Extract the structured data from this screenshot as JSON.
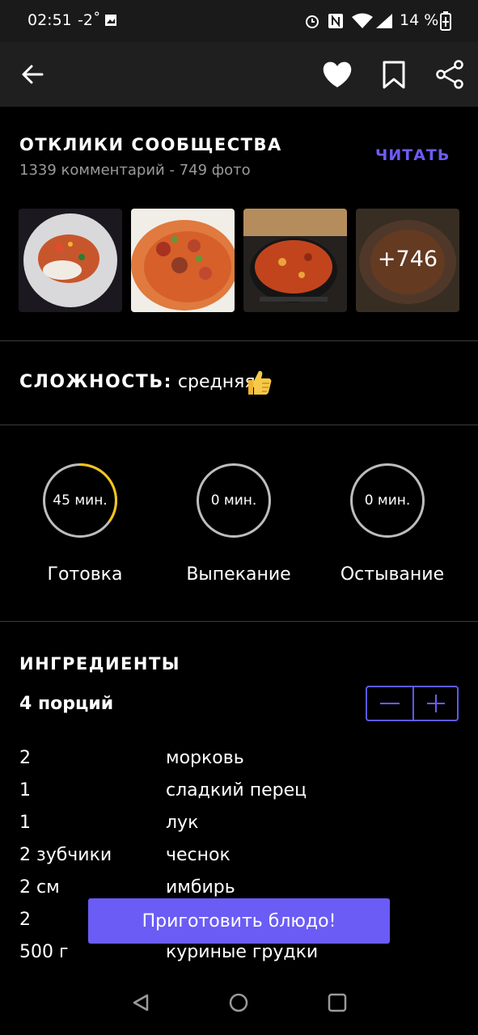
{
  "status": {
    "time": "02:51",
    "temp": "-2˚",
    "battery": "14 %"
  },
  "header": {
    "back_icon": "arrow-left-icon",
    "favorite_icon": "heart-icon",
    "bookmark_icon": "bookmark-icon",
    "share_icon": "share-icon"
  },
  "community": {
    "title": "ОТКЛИКИ СООБЩЕСТВА",
    "subtitle": "1339 комментарий - 749 фото",
    "read_label": "ЧИТАТЬ",
    "more_photos": "+746"
  },
  "difficulty": {
    "label": "СЛОЖНОСТЬ:",
    "value": "средняя",
    "icon": "thumbs-up-icon"
  },
  "times": [
    {
      "value": "45 мин.",
      "label": "Готовка",
      "progress": 0.35
    },
    {
      "value": "0 мин.",
      "label": "Выпекание",
      "progress": 0
    },
    {
      "value": "0 мин.",
      "label": "Остывание",
      "progress": 0
    }
  ],
  "ingredients": {
    "title": "ИНГРЕДИЕНТЫ",
    "portions": "4 порций",
    "minus_label": "−",
    "plus_label": "+",
    "items": [
      {
        "qty": "2",
        "name": "морковь"
      },
      {
        "qty": "1",
        "name": "сладкий перец"
      },
      {
        "qty": "1",
        "name": "лук"
      },
      {
        "qty": "2 зубчики",
        "name": "чеснок"
      },
      {
        "qty": "2 см",
        "name": "имбирь"
      },
      {
        "qty": "2",
        "name": ""
      },
      {
        "qty": "500 г",
        "name": "куриные грудки"
      }
    ]
  },
  "cta_label": "Приготовить блюдо!",
  "colors": {
    "accent": "#6b5cf5",
    "progress": "#f5c518"
  }
}
